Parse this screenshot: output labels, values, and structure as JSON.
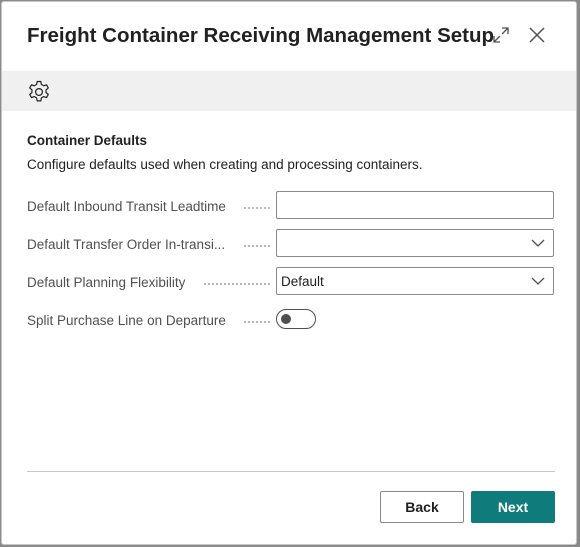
{
  "dialog": {
    "title": "Freight Container Receiving Management Setup",
    "expand_icon": "expand-icon",
    "close_icon": "close-icon"
  },
  "action_bar": {
    "settings_icon": "gear-icon"
  },
  "section": {
    "title": "Container Defaults",
    "description": "Configure defaults used when creating and processing containers."
  },
  "fields": {
    "inbound_leadtime": {
      "label": "Default Inbound Transit Leadtime",
      "value": ""
    },
    "transfer_order": {
      "label": "Default Transfer Order In-transi...",
      "value": ""
    },
    "planning_flexibility": {
      "label": "Default Planning Flexibility",
      "value": "Default"
    },
    "split_purchase_line": {
      "label": "Split Purchase Line on Departure",
      "enabled": false
    }
  },
  "footer": {
    "back_label": "Back",
    "next_label": "Next"
  },
  "colors": {
    "accent": "#0f7b7a",
    "action_bar": "#f0f0f0"
  }
}
